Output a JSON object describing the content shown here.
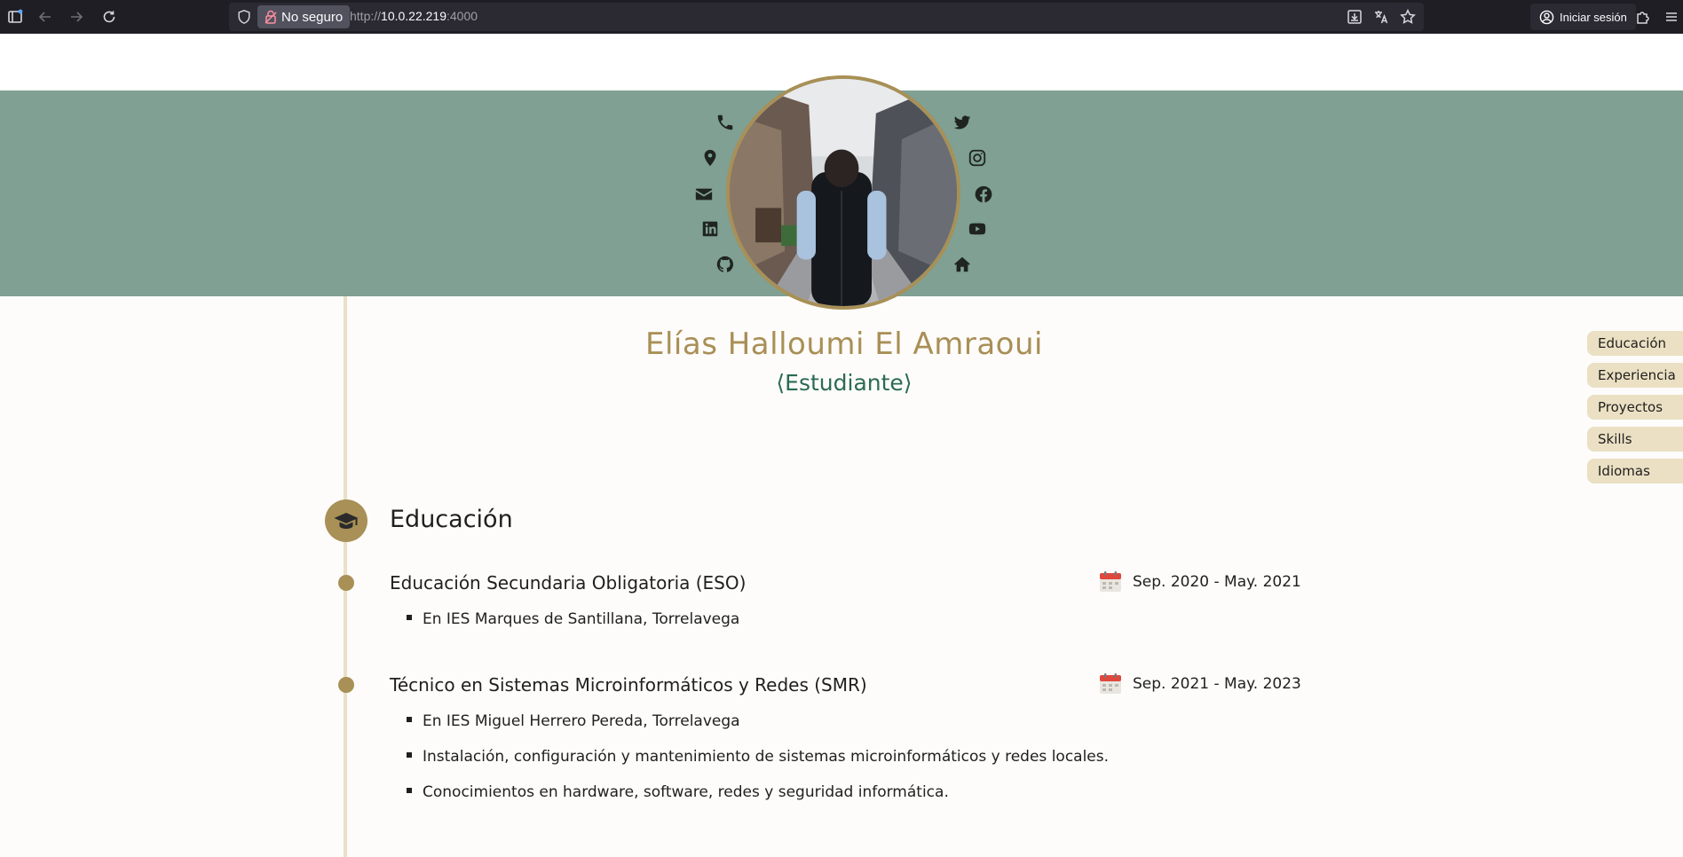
{
  "browser": {
    "security_label": "No seguro",
    "url_scheme": "http://",
    "url_host": "10.0.22.219",
    "url_port": ":4000",
    "signin_label": "Iniciar sesión"
  },
  "profile": {
    "name": "Elías Halloumi El Amraoui",
    "role": "⟨Estudiante⟩"
  },
  "nav": [
    {
      "label": "Educación"
    },
    {
      "label": "Experiencia"
    },
    {
      "label": "Proyectos"
    },
    {
      "label": "Skills"
    },
    {
      "label": "Idiomas"
    }
  ],
  "education": {
    "title": "Educación",
    "entries": [
      {
        "title": "Educación Secundaria Obligatoria (ESO)",
        "date": "Sep. 2020 - May. 2021",
        "bullets": [
          "En IES Marques de Santillana, Torrelavega"
        ]
      },
      {
        "title": "Técnico en Sistemas Microinformáticos y Redes (SMR)",
        "date": "Sep. 2021 - May. 2023",
        "bullets": [
          "En IES Miguel Herrero Pereda, Torrelavega",
          "Instalación, configuración y mantenimiento de sistemas microinformáticos y redes locales.",
          "Conocimientos en hardware, software, redes y seguridad informática."
        ]
      }
    ]
  },
  "colors": {
    "banner": "#7fa093",
    "accent_gold": "#a89056",
    "role_green": "#2b6a56",
    "nav_bg": "#ebe0c3"
  }
}
